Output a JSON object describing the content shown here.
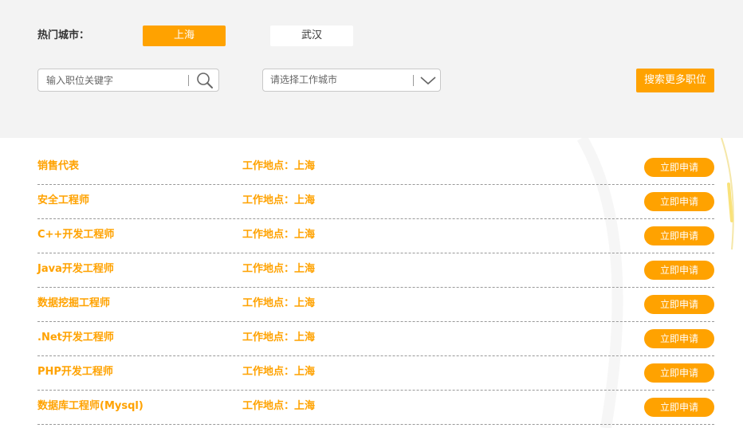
{
  "filters": {
    "hot_cities_label": "热门城市：",
    "cities": [
      {
        "label": "上海",
        "active": true
      },
      {
        "label": "武汉",
        "active": false
      }
    ],
    "keyword_placeholder": "输入职位关键字",
    "city_select_placeholder": "请选择工作城市",
    "search_more_label": "搜索更多职位"
  },
  "jobs": [
    {
      "title": "销售代表",
      "location": "工作地点：上海",
      "apply_label": "立即申请"
    },
    {
      "title": "安全工程师",
      "location": "工作地点：上海",
      "apply_label": "立即申请"
    },
    {
      "title": "C++开发工程师",
      "location": "工作地点：上海",
      "apply_label": "立即申请"
    },
    {
      "title": "Java开发工程师",
      "location": "工作地点：上海",
      "apply_label": "立即申请"
    },
    {
      "title": "数据挖掘工程师",
      "location": "工作地点：上海",
      "apply_label": "立即申请"
    },
    {
      "title": ".Net开发工程师",
      "location": "工作地点：上海",
      "apply_label": "立即申请"
    },
    {
      "title": "PHP开发工程师",
      "location": "工作地点：上海",
      "apply_label": "立即申请"
    },
    {
      "title": "数据库工程师(Mysql)",
      "location": "工作地点：上海",
      "apply_label": "立即申请"
    }
  ],
  "colors": {
    "accent": "#ffa200",
    "panel_bg": "#f3f3f3"
  },
  "icons": {
    "search": "search-icon",
    "dropdown": "chevron-down-icon"
  }
}
